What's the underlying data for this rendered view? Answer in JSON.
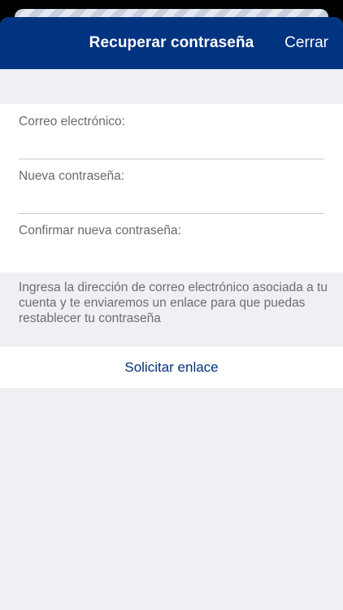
{
  "header": {
    "title": "Recuperar contraseña",
    "close_label": "Cerrar"
  },
  "form": {
    "email": {
      "label": "Correo electrónico:",
      "value": ""
    },
    "new_password": {
      "label": "Nueva contraseña:",
      "value": ""
    },
    "confirm_password": {
      "label": "Confirmar nueva contraseña:",
      "value": ""
    }
  },
  "help_text": "Ingresa la dirección de correo electrónico asociada a tu cuenta y te enviaremos un enlace para que puedas restablecer tu contraseña",
  "actions": {
    "request_link_label": "Solicitar enlace"
  },
  "colors": {
    "brand": "#003380",
    "background": "#efeff4"
  }
}
